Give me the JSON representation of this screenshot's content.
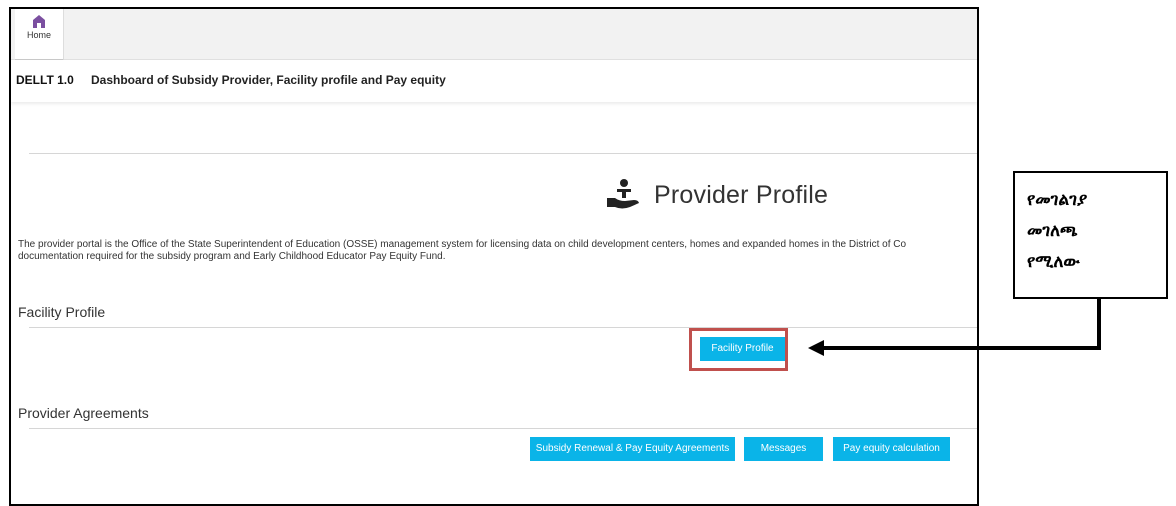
{
  "topbar": {
    "home_label": "Home"
  },
  "header": {
    "app_name": "DELLT 1.0",
    "title": "Dashboard of Subsidy Provider, Facility profile and Pay equity"
  },
  "profile": {
    "heading": "Provider Profile"
  },
  "description": {
    "line1": "The provider portal is the Office of the State Superintendent of Education (OSSE) management system for licensing data on child development centers, homes and expanded homes in the District of Co",
    "line2": "documentation required for the subsidy program and Early Childhood Educator Pay Equity Fund."
  },
  "facility_section": {
    "title": "Facility Profile",
    "button_label": "Facility Profile"
  },
  "agreements_section": {
    "title": "Provider Agreements",
    "buttons": [
      {
        "label": "Subsidy Renewal & Pay Equity Agreements"
      },
      {
        "label": "Messages"
      },
      {
        "label": "Pay equity calculation"
      }
    ]
  },
  "callout": {
    "lines": [
      "የመገልገያ",
      "መገለጫ",
      "የሚለው"
    ]
  },
  "colors": {
    "accent": "#0ab4e8",
    "highlight": "#c0504d",
    "home_icon": "#7b4fa0"
  },
  "icons": {
    "home": "home-icon",
    "provider": "hand-child-icon"
  }
}
